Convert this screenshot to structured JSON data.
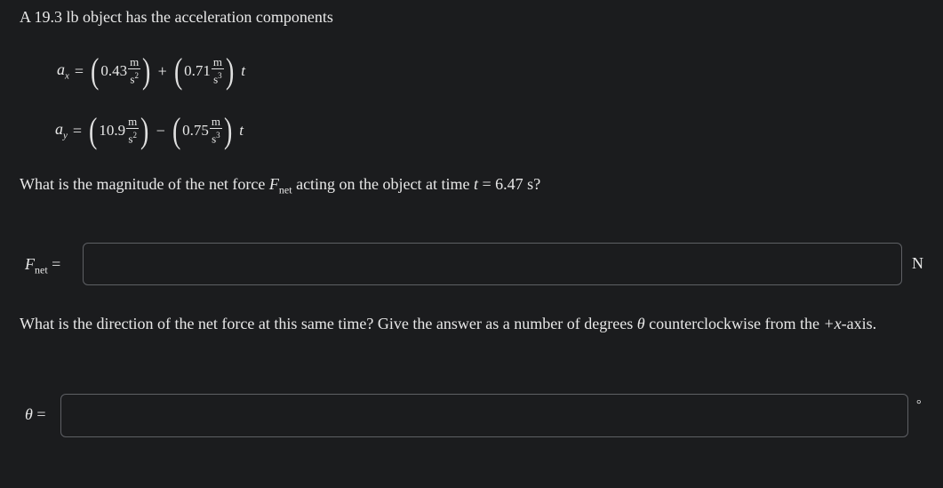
{
  "problem": {
    "intro": "A 19.3 lb object has the acceleration components",
    "ax": {
      "var": "a",
      "sub": "x",
      "c1": "0.43",
      "u1_top": "m",
      "u1_bot": "s",
      "u1_exp": "2",
      "op": "+",
      "c2": "0.71",
      "u2_top": "m",
      "u2_bot": "s",
      "u2_exp": "3",
      "t": "t"
    },
    "ay": {
      "var": "a",
      "sub": "y",
      "c1": "10.9",
      "u1_top": "m",
      "u1_bot": "s",
      "u1_exp": "2",
      "op": "−",
      "c2": "0.75",
      "u2_top": "m",
      "u2_bot": "s",
      "u2_exp": "3",
      "t": "t"
    },
    "eq_sign": "=",
    "q1_pre": "What is the magnitude of the net force ",
    "q1_F": "F",
    "q1_Fsub": "net",
    "q1_mid": " acting on the object at time ",
    "q1_t": "t",
    "q1_post": " = 6.47 s?",
    "q2_pre": "What is the direction of the net force at this same time? Give the answer as a number of degrees ",
    "q2_theta": "θ",
    "q2_mid": " counterclockwise from the ",
    "q2_axis": "+x",
    "q2_post": "-axis."
  },
  "answers": {
    "fnet_label_F": "F",
    "fnet_label_sub": "net",
    "fnet_label_eq": " =",
    "fnet_value": "",
    "fnet_unit": "N",
    "theta_label": "θ",
    "theta_label_eq": " =",
    "theta_value": "",
    "theta_unit": "°"
  }
}
